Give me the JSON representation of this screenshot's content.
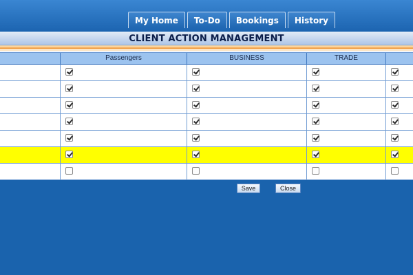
{
  "nav": {
    "tabs": [
      {
        "label": "My Home"
      },
      {
        "label": "To-Do"
      },
      {
        "label": "Bookings"
      },
      {
        "label": "History"
      }
    ]
  },
  "page_title": "CLIENT ACTION MANAGEMENT",
  "table": {
    "columns": [
      "",
      "Passengers",
      "BUSINESS",
      "TRADE",
      ""
    ],
    "rows": [
      {
        "label": "",
        "highlighted": false,
        "checks": [
          true,
          true,
          true,
          true
        ]
      },
      {
        "label": "",
        "highlighted": false,
        "checks": [
          true,
          true,
          true,
          true
        ]
      },
      {
        "label": "",
        "highlighted": false,
        "checks": [
          true,
          true,
          true,
          true
        ]
      },
      {
        "label": "",
        "highlighted": false,
        "checks": [
          true,
          true,
          true,
          true
        ]
      },
      {
        "label": "",
        "highlighted": false,
        "checks": [
          true,
          true,
          true,
          true
        ]
      },
      {
        "label": "",
        "highlighted": true,
        "checks": [
          true,
          true,
          true,
          true
        ]
      },
      {
        "label": "",
        "highlighted": false,
        "checks": [
          false,
          false,
          false,
          false
        ]
      }
    ],
    "highlight_color": "#ffff00"
  },
  "actions": {
    "save_label": "Save",
    "close_label": "Close"
  },
  "colors": {
    "background": "#1a63ad",
    "header_row": "#9cc3ef"
  }
}
